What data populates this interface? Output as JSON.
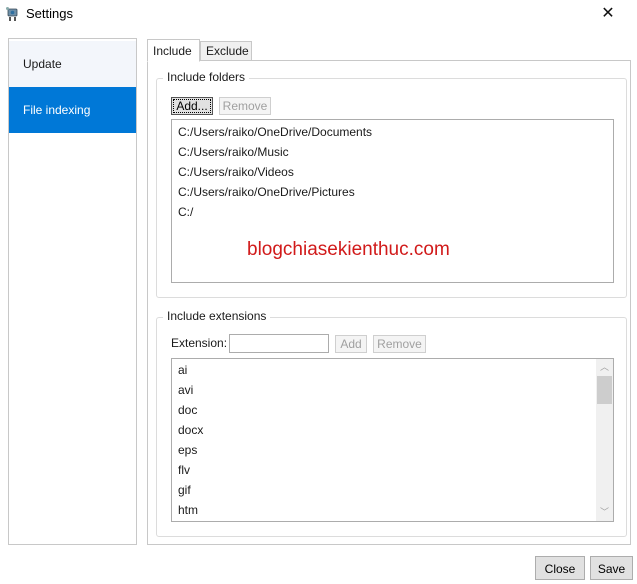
{
  "window": {
    "title": "Settings",
    "app_icon": "settings-app-icon",
    "close_glyph": "✕"
  },
  "sidebar": {
    "items": [
      {
        "label": "Update",
        "active": false
      },
      {
        "label": "File indexing",
        "active": true
      }
    ],
    "active_color": "#0078d7"
  },
  "tabs": [
    {
      "label": "Include",
      "active": true
    },
    {
      "label": "Exclude",
      "active": false
    }
  ],
  "include_folders": {
    "legend": "Include folders",
    "add_label": "Add...",
    "remove_label": "Remove",
    "remove_enabled": false,
    "folders": [
      "C:/Users/raiko/OneDrive/Documents",
      "C:/Users/raiko/Music",
      "C:/Users/raiko/Videos",
      "C:/Users/raiko/OneDrive/Pictures",
      "C:/"
    ]
  },
  "watermark": "blogchiasekienthuc.com",
  "include_extensions": {
    "legend": "Include extensions",
    "extension_label": "Extension:",
    "extension_value": "",
    "add_label": "Add",
    "remove_label": "Remove",
    "extensions": [
      "ai",
      "avi",
      "doc",
      "docx",
      "eps",
      "flv",
      "gif",
      "htm"
    ],
    "scroll_up_glyph": "︿",
    "scroll_down_glyph": "﹀"
  },
  "footer": {
    "close_label": "Close",
    "save_label": "Save"
  }
}
